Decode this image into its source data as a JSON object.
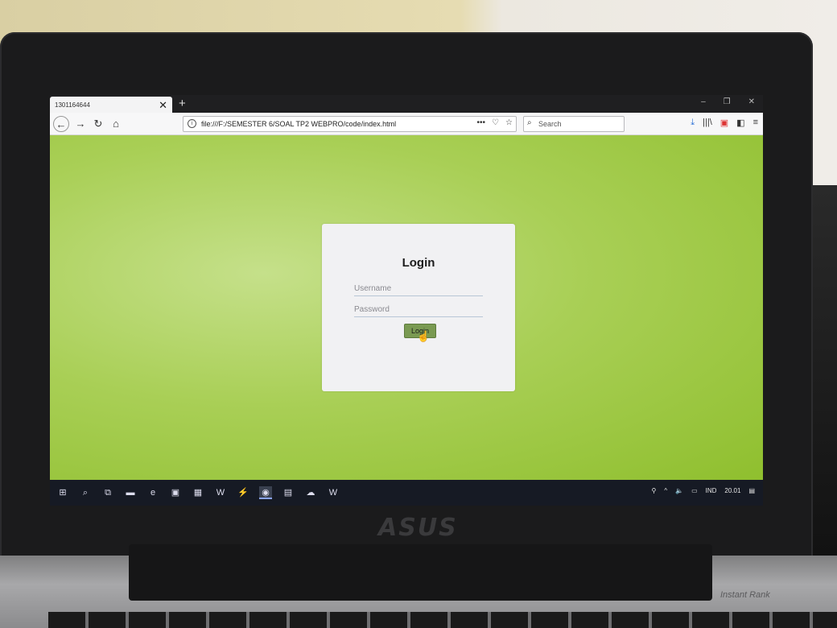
{
  "browser": {
    "tab_title": "1301164644",
    "tab_close": "✕",
    "new_tab": "+",
    "url": "file:///F:/SEMESTER 6/SOAL TP2 WEBPRO/code/index.html",
    "search_placeholder": "Search",
    "window_controls": {
      "minimize": "–",
      "restore": "❐",
      "close": "✕"
    },
    "nav": {
      "back": "←",
      "forward": "→",
      "reload": "↻",
      "home": "⌂"
    },
    "url_actions": {
      "more": "•••",
      "pocket": "♡",
      "bookmark": "☆"
    },
    "tools": {
      "download": "⤓",
      "library": "|||\\",
      "pocket_app": "▣",
      "sidebar": "◧",
      "menu": "≡"
    }
  },
  "login": {
    "title": "Login",
    "username_placeholder": "Username",
    "password_placeholder": "Password",
    "button_label": "Login"
  },
  "taskbar": {
    "items": [
      "⊞",
      "⌕",
      "⧉",
      "▬",
      "e",
      "▣",
      "▦",
      "W",
      "⚡",
      "◉",
      "▤",
      "☁",
      "W"
    ],
    "language": "IND",
    "time": "20.01",
    "tray_icons": [
      "⚲",
      "^",
      "🔈",
      "▭"
    ],
    "notification_icon": "▤"
  },
  "laptop": {
    "brand": "ASUS",
    "base_label": "Instant Rank"
  },
  "colors": {
    "page_background": "#a9cf56",
    "card_background": "#f1f1f3",
    "login_button": "#7a9a52",
    "taskbar": "#161a24"
  }
}
